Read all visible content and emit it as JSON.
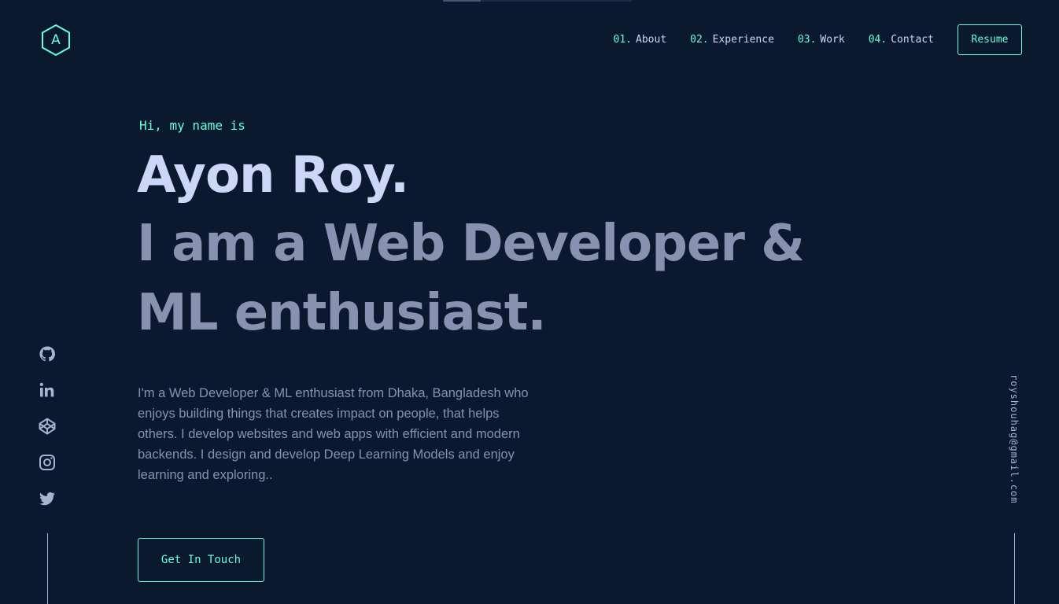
{
  "colors": {
    "background": "#0a192f",
    "accent": "#64ffda",
    "heading": "#ccd6f6",
    "text": "#8892b0",
    "muted": "#a8b2d1"
  },
  "logo": {
    "letter": "A",
    "icon": "hexagon-logo-icon"
  },
  "nav": {
    "items": [
      {
        "num": "01.",
        "label": "About"
      },
      {
        "num": "02.",
        "label": "Experience"
      },
      {
        "num": "03.",
        "label": "Work"
      },
      {
        "num": "04.",
        "label": "Contact"
      }
    ],
    "resume_label": "Resume"
  },
  "hero": {
    "intro": "Hi, my name is",
    "name": "Ayon Roy.",
    "tagline": "I am a Web Developer & ML enthusiast.",
    "bio": "I'm a Web Developer & ML enthusiast from Dhaka, Bangladesh who enjoys building things that creates impact on people, that helps others. I develop websites and web apps with efficient and modern backends. I design and develop Deep Learning Models and enjoy learning and exploring..",
    "cta_label": "Get In Touch"
  },
  "social": {
    "icons": [
      "github-icon",
      "linkedin-icon",
      "codepen-icon",
      "instagram-icon",
      "twitter-icon"
    ]
  },
  "email": "royshouhag@gmail.com"
}
